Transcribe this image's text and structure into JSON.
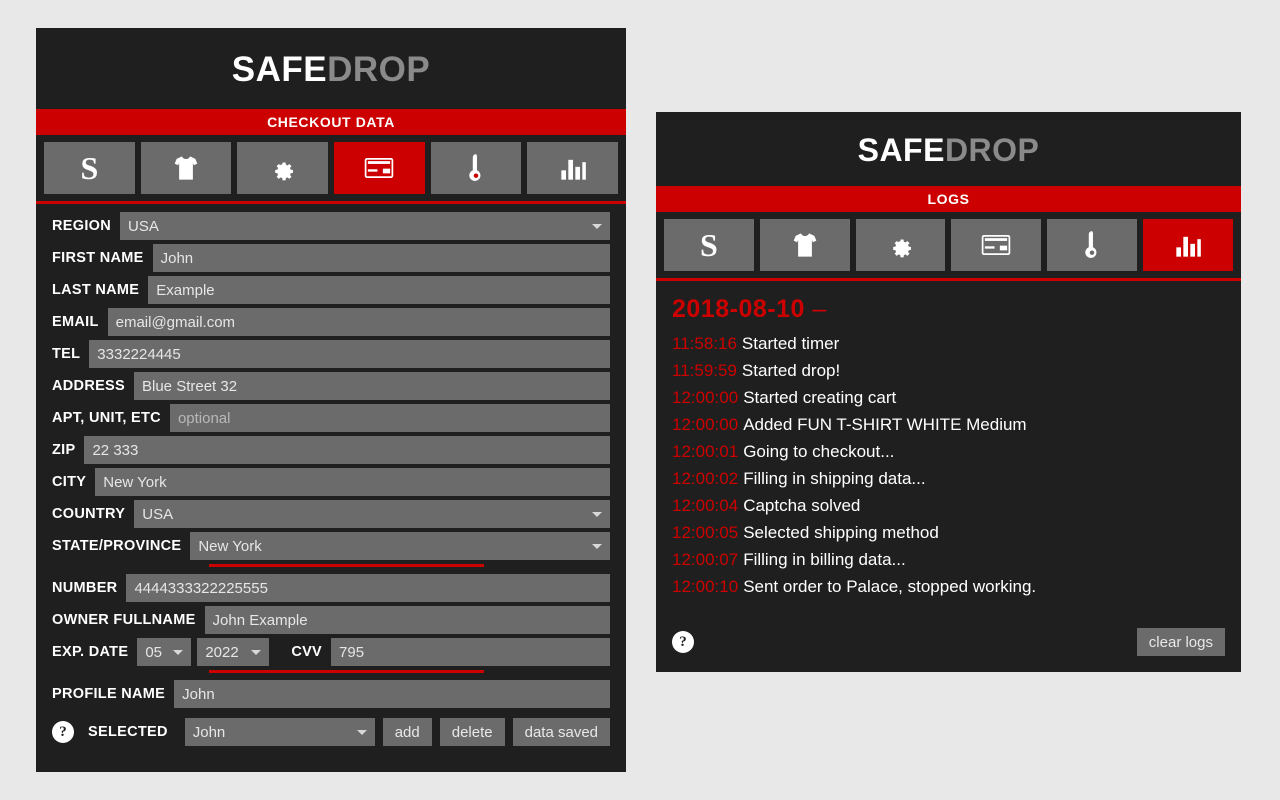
{
  "brand": {
    "part1": "SAFE",
    "part2": "DROP"
  },
  "checkout": {
    "section_title": "CHECKOUT DATA",
    "tabs": [
      {
        "name": "tab-stripe",
        "icon": "letter-s-icon",
        "active": false
      },
      {
        "name": "tab-product",
        "icon": "tshirt-icon",
        "active": false
      },
      {
        "name": "tab-settings",
        "icon": "gear-icon",
        "active": false
      },
      {
        "name": "tab-checkout-data",
        "icon": "credit-card-icon",
        "active": true
      },
      {
        "name": "tab-monitor",
        "icon": "thermometer-icon",
        "active": false
      },
      {
        "name": "tab-logs",
        "icon": "bar-chart-icon",
        "active": false
      }
    ],
    "fields": {
      "region": {
        "label": "REGION",
        "value": "USA"
      },
      "first_name": {
        "label": "FIRST NAME",
        "value": "John"
      },
      "last_name": {
        "label": "LAST NAME",
        "value": "Example"
      },
      "email": {
        "label": "EMAIL",
        "value": "email@gmail.com"
      },
      "tel": {
        "label": "TEL",
        "value": "3332224445"
      },
      "address": {
        "label": "ADDRESS",
        "value": "Blue Street 32"
      },
      "apt": {
        "label": "APT, UNIT, ETC",
        "placeholder": "optional",
        "value": ""
      },
      "zip": {
        "label": "ZIP",
        "value": "22 333"
      },
      "city": {
        "label": "CITY",
        "value": "New York"
      },
      "country": {
        "label": "COUNTRY",
        "value": "USA"
      },
      "state": {
        "label": "STATE/PROVINCE",
        "value": "New York"
      },
      "number": {
        "label": "NUMBER",
        "value": "4444333322225555"
      },
      "owner": {
        "label": "OWNER FULLNAME",
        "value": "John Example"
      },
      "exp_date": {
        "label": "EXP. DATE",
        "month": "05",
        "year": "2022"
      },
      "cvv": {
        "label": "CVV",
        "value": "795"
      },
      "profile_name": {
        "label": "PROFILE NAME",
        "value": "John"
      }
    },
    "bottom": {
      "help": "?",
      "selected_label": "SELECTED",
      "selected_value": "John",
      "add_label": "add",
      "delete_label": "delete",
      "status_label": "data saved"
    }
  },
  "logs": {
    "section_title": "LOGS",
    "tabs": [
      {
        "name": "tab-stripe",
        "icon": "letter-s-icon",
        "active": false
      },
      {
        "name": "tab-product",
        "icon": "tshirt-icon",
        "active": false
      },
      {
        "name": "tab-settings",
        "icon": "gear-icon",
        "active": false
      },
      {
        "name": "tab-checkout-data",
        "icon": "credit-card-icon",
        "active": false
      },
      {
        "name": "tab-monitor",
        "icon": "thermometer-icon",
        "active": false
      },
      {
        "name": "tab-logs",
        "icon": "bar-chart-icon",
        "active": true
      }
    ],
    "date_header": "2018-08-10",
    "date_dash": "–",
    "entries": [
      {
        "time": "11:58:16",
        "message": "Started timer"
      },
      {
        "time": "11:59:59",
        "message": "Started drop!"
      },
      {
        "time": "12:00:00",
        "message": "Started creating cart"
      },
      {
        "time": "12:00:00",
        "message": "Added FUN T-SHIRT WHITE Medium"
      },
      {
        "time": "12:00:01",
        "message": "Going to checkout..."
      },
      {
        "time": "12:00:02",
        "message": "Filling in shipping data..."
      },
      {
        "time": "12:00:04",
        "message": "Captcha solved"
      },
      {
        "time": "12:00:05",
        "message": "Selected shipping method"
      },
      {
        "time": "12:00:07",
        "message": "Filling in billing data..."
      },
      {
        "time": "12:00:10",
        "message": "Sent order to Palace, stopped working."
      }
    ],
    "footer": {
      "help": "?",
      "clear_label": "clear logs"
    }
  },
  "colors": {
    "accent_red": "#cc0000",
    "panel_bg": "#1f1f1f",
    "field_bg": "#6b6b6b",
    "page_bg": "#e8e8e8"
  }
}
